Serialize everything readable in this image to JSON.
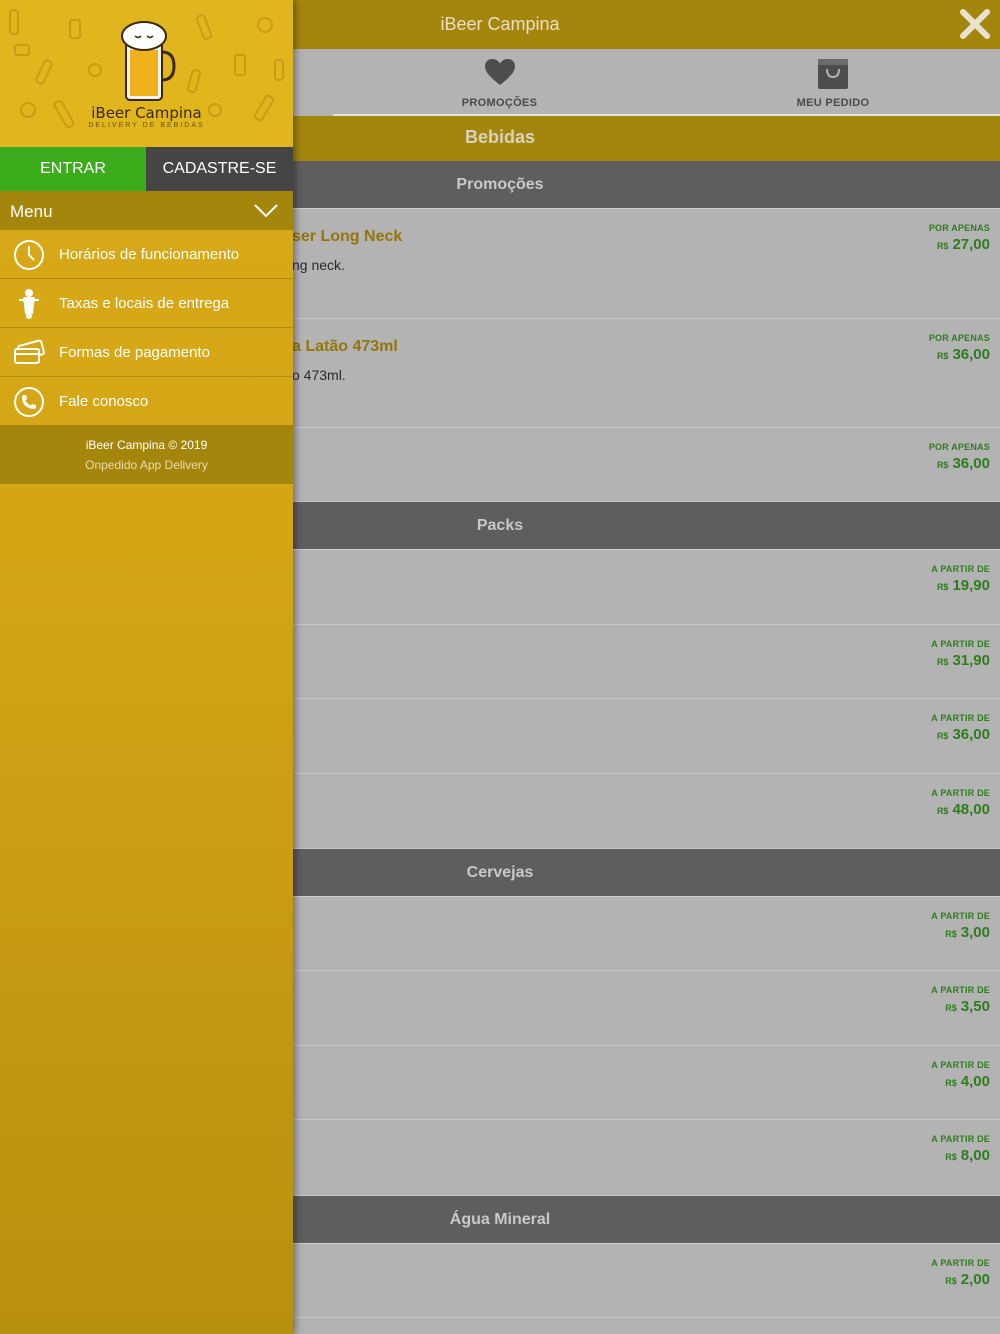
{
  "app": {
    "title": "iBeer Campina",
    "tabs": [
      {
        "label": "PROMOÇÕES",
        "icon": "heart-icon"
      },
      {
        "label": "MEU PEDIDO",
        "icon": "shopping-bag-icon"
      }
    ],
    "category": "Bebidas",
    "sections": [
      {
        "title": "Promoções",
        "items": [
          {
            "name": "ser Long Neck",
            "desc": "ng neck.",
            "price_label": "POR APENAS",
            "currency": "R$",
            "price": "27,00"
          },
          {
            "name": "a Latão 473ml",
            "desc": "o 473ml.",
            "price_label": "POR APENAS",
            "currency": "R$",
            "price": "36,00"
          },
          {
            "name": "",
            "desc": "",
            "price_label": "POR APENAS",
            "currency": "R$",
            "price": "36,00"
          }
        ]
      },
      {
        "title": "Packs",
        "items": [
          {
            "price_label": "A PARTIR DE",
            "currency": "R$",
            "price": "19,90"
          },
          {
            "price_label": "A PARTIR DE",
            "currency": "R$",
            "price": "31,90"
          },
          {
            "price_label": "A PARTIR DE",
            "currency": "R$",
            "price": "36,00"
          },
          {
            "price_label": "A PARTIR DE",
            "currency": "R$",
            "price": "48,00"
          }
        ]
      },
      {
        "title": "Cervejas",
        "items": [
          {
            "price_label": "A PARTIR DE",
            "currency": "R$",
            "price": "3,00"
          },
          {
            "price_label": "A PARTIR DE",
            "currency": "R$",
            "price": "3,50"
          },
          {
            "price_label": "A PARTIR DE",
            "currency": "R$",
            "price": "4,00"
          },
          {
            "price_label": "A PARTIR DE",
            "currency": "R$",
            "price": "8,00"
          }
        ]
      },
      {
        "title": "Água Mineral",
        "items": [
          {
            "price_label": "A PARTIR DE",
            "currency": "R$",
            "price": "2,00"
          }
        ]
      }
    ]
  },
  "drawer": {
    "brand": "iBeer Campina",
    "tagline": "DELIVERY DE BEBIDAS",
    "login_label": "ENTRAR",
    "signup_label": "CADASTRE-SE",
    "menu_title": "Menu",
    "items": [
      {
        "label": "Horários de funcionamento",
        "icon": "clock-icon"
      },
      {
        "label": "Taxas e locais de entrega",
        "icon": "delivery-scooter-icon"
      },
      {
        "label": "Formas de pagamento",
        "icon": "payment-card-icon"
      },
      {
        "label": "Fale conosco",
        "icon": "phone-icon"
      }
    ],
    "footer_line1": "iBeer Campina © 2019",
    "footer_line2": "Onpedido App Delivery"
  },
  "colors": {
    "brand_gold": "#a5860d",
    "drawer_yellow": "#d9aa18",
    "login_green": "#3cab1c",
    "price_green": "#2e7d1e",
    "section_gray": "#5e5e5e"
  }
}
